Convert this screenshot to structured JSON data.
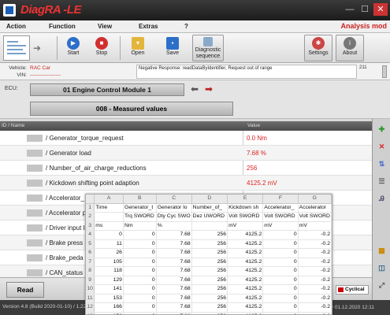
{
  "app": {
    "title": "DiagRA -LE"
  },
  "window": {
    "min_glyph": "—",
    "max_glyph": "☐",
    "close_glyph": "✕"
  },
  "menu": {
    "items": [
      "Action",
      "Function",
      "View",
      "Extras",
      "?"
    ],
    "mode": "Analysis mod"
  },
  "toolbar": {
    "start": "Start",
    "stop": "Stop",
    "open": "Open",
    "save": "Save",
    "diagnostic_line1": "Diagnostic",
    "diagnostic_line2": "sequence",
    "settings": "Settings",
    "about": "About"
  },
  "vehicle": {
    "vehicle_label": "Vehicle:",
    "vehicle_value": "RAC Car",
    "vin_label": "VIN:",
    "vin_value": "------------------",
    "response": "Negative Response: readDataByIdentifier, Request out of range",
    "side_number": "211"
  },
  "ecu": {
    "label": "ECU:",
    "value": "01  Engine Control Module 1"
  },
  "function": {
    "value": "008 - Measured values"
  },
  "grid": {
    "col_name": "ID / Name",
    "col_value": "Value",
    "rows": [
      {
        "name": "/ Generator_torque_request",
        "value": "0.0 Nm"
      },
      {
        "name": "/ Generator load",
        "value": "7.68 %"
      },
      {
        "name": "/ Number_of_air_charge_reductions",
        "value": "256"
      },
      {
        "name": "/ Kickdown shifting point adaption",
        "value": "4125.2 mV"
      },
      {
        "name": "/ Accelerator_",
        "value": ""
      },
      {
        "name": "/ Accelerator p",
        "value": ""
      },
      {
        "name": "/ Driver input li",
        "value": ""
      },
      {
        "name": "/ Brake press",
        "value": ""
      },
      {
        "name": "/ Brake_peda",
        "value": ""
      },
      {
        "name": "/ CAN_status",
        "value": ""
      }
    ]
  },
  "sheet": {
    "col_letters": [
      "A",
      "B",
      "C",
      "D",
      "E",
      "F",
      "G"
    ],
    "row1": [
      "Time",
      "Generator_t",
      "Generator lo",
      "Number_of_",
      "Kickdown sh",
      "Accelerator_",
      "Accelerator"
    ],
    "row2": [
      "",
      "Trq SWORD",
      "Dty Cyc SWO",
      "Dez UWORD",
      "Volt SWORD",
      "Volt SWORD",
      "Volt SWORD"
    ],
    "row3": [
      "ms",
      "Nm",
      "%",
      "",
      "mV",
      "mV",
      "mV"
    ],
    "data": [
      [
        "0",
        "0",
        "7.68",
        "256",
        "4125.2",
        "0",
        "-0.2"
      ],
      [
        "11",
        "0",
        "7.68",
        "256",
        "4125.2",
        "0",
        "-0.2"
      ],
      [
        "26",
        "0",
        "7.68",
        "256",
        "4125.2",
        "0",
        "-0.2"
      ],
      [
        "105",
        "0",
        "7.68",
        "256",
        "4125.2",
        "0",
        "-0.2"
      ],
      [
        "118",
        "0",
        "7.68",
        "256",
        "4125.2",
        "0",
        "-0.2"
      ],
      [
        "129",
        "0",
        "7.68",
        "256",
        "4125.2",
        "0",
        "-0.2"
      ],
      [
        "141",
        "0",
        "7.68",
        "256",
        "4125.2",
        "0",
        "-0.2"
      ],
      [
        "153",
        "0",
        "7.68",
        "256",
        "4125.2",
        "0",
        "-0.2"
      ],
      [
        "166",
        "0",
        "7.68",
        "256",
        "4125.2",
        "0",
        "-0.2"
      ],
      [
        "178",
        "0",
        "7.68",
        "256",
        "4125.2",
        "0",
        "-0.2"
      ]
    ]
  },
  "bottom": {
    "read": "Read",
    "cyclic": "Cyclical"
  },
  "status": {
    "left": "Version 4.8 (Build 2020-01-10) / 1.22",
    "right": "En  ▾  01.12.2020 12:11"
  },
  "colors": {
    "accent_red": "#d22222",
    "brand_blue": "#1a5fb4"
  }
}
